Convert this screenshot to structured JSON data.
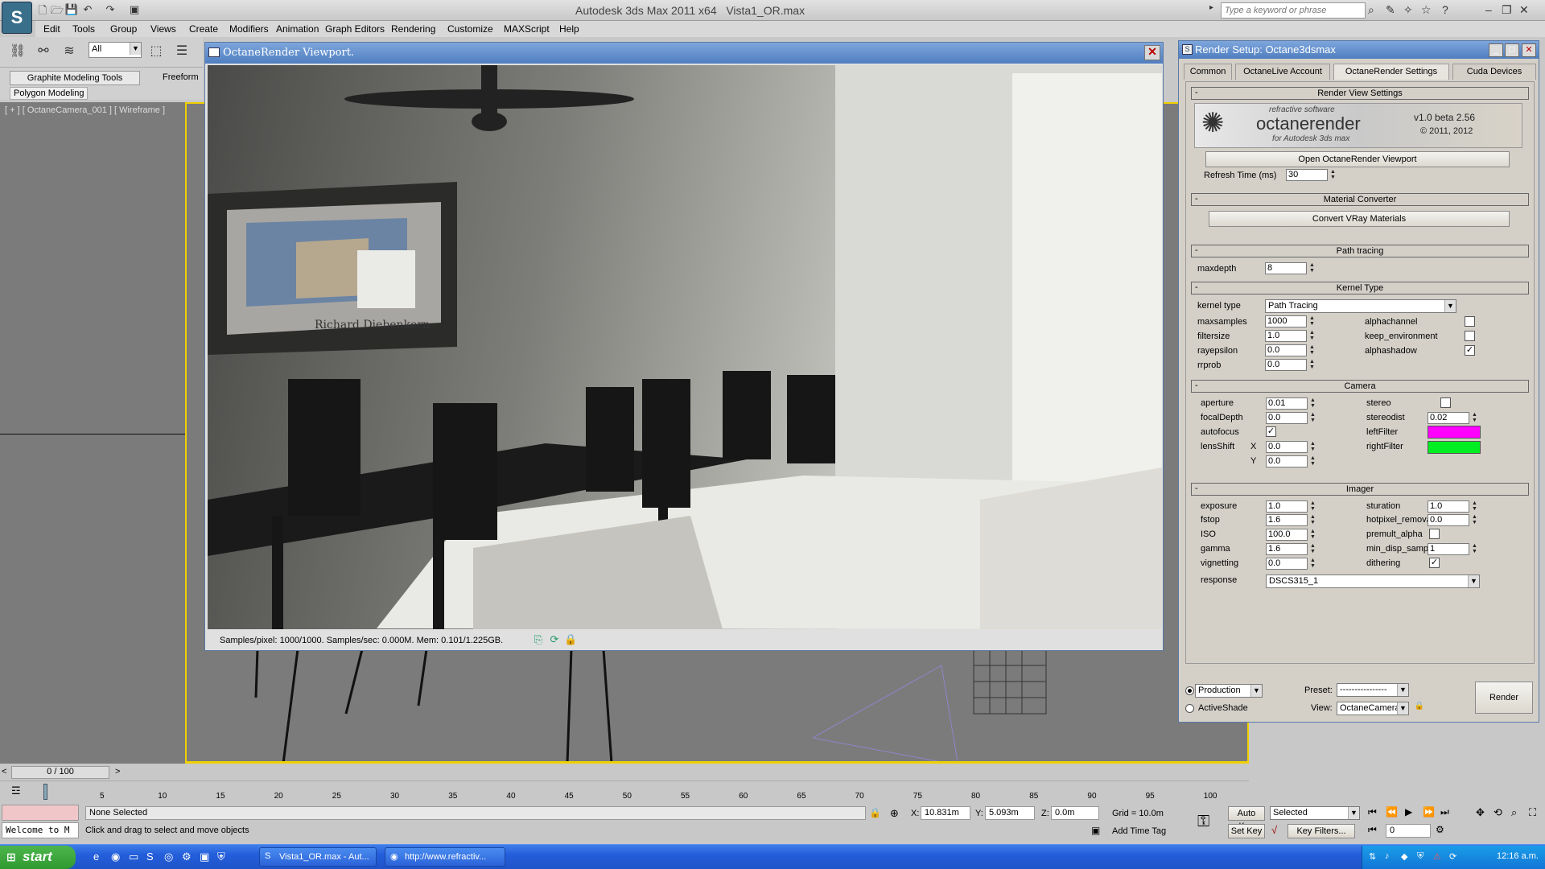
{
  "titlebar": {
    "app_title": "Autodesk 3ds Max  2011 x64",
    "file_name": "Vista1_OR.max",
    "search_placeholder": "Type a keyword or phrase",
    "logo": "3ds-max-logo"
  },
  "menu": [
    "Edit",
    "Tools",
    "Group",
    "Views",
    "Create",
    "Modifiers",
    "Animation",
    "Graph Editors",
    "Rendering",
    "Customize",
    "MAXScript",
    "Help"
  ],
  "toolbar": {
    "selection_filter": "All"
  },
  "ribbon": {
    "tab_graphite": "Graphite Modeling Tools",
    "tab_freeform": "Freeform",
    "sub_polygon": "Polygon Modeling"
  },
  "viewport": {
    "label": "[ + ] [ OctaneCamera_001 ] [ Wireframe ]"
  },
  "octane_viewport": {
    "title": "OctaneRender Viewport.",
    "status": "Samples/pixel: 1000/1000. Samples/sec: 0.000M. Mem: 0.101/1.225GB.",
    "close": "✕",
    "painting_text": "Richard Diebenkorn"
  },
  "render_setup": {
    "title": "Render Setup: Octane3dsmax",
    "tabs": [
      "Common",
      "OctaneLive Account",
      "OctaneRender Settings",
      "Cuda Devices"
    ],
    "render_view_settings": {
      "header": "Render View Settings",
      "banner_brand": "octanerender",
      "banner_sub": "for Autodesk 3ds max",
      "banner_company": "refractive software",
      "banner_version": "v1.0 beta 2.56",
      "banner_copy": "© 2011, 2012",
      "open_button": "Open OctaneRender Viewport",
      "refresh_label": "Refresh Time (ms)",
      "refresh_value": "30"
    },
    "material_converter": {
      "header": "Material Converter",
      "convert_button": "Convert VRay Materials"
    },
    "path_tracing": {
      "header": "Path tracing",
      "maxdepth_label": "maxdepth",
      "maxdepth_value": "8"
    },
    "kernel": {
      "header": "Kernel Type",
      "kernel_type_label": "kernel type",
      "kernel_type_value": "Path Tracing",
      "maxsamples_label": "maxsamples",
      "maxsamples_value": "1000",
      "filtersize_label": "filtersize",
      "filtersize_value": "1.0",
      "rayepsilon_label": "rayepsilon",
      "rayepsilon_value": "0.0",
      "rrprob_label": "rrprob",
      "rrprob_value": "0.0",
      "alphachannel_label": "alphachannel",
      "alphachannel": false,
      "keep_env_label": "keep_environment",
      "keep_env": false,
      "alphashadow_label": "alphashadow",
      "alphashadow": true
    },
    "camera": {
      "header": "Camera",
      "aperture_label": "aperture",
      "aperture_value": "0.01",
      "focal_label": "focalDepth",
      "focal_value": "0.0",
      "autofocus_label": "autofocus",
      "autofocus": true,
      "lensshift_label": "lensShift",
      "x_label": "X",
      "x_value": "0.0",
      "y_label": "Y",
      "y_value": "0.0",
      "stereo_label": "stereo",
      "stereo": false,
      "stereodist_label": "stereodist",
      "stereodist_value": "0.02",
      "leftfilter_label": "leftFilter",
      "leftfilter_color": "#ff00ff",
      "rightfilter_label": "rightFilter",
      "rightfilter_color": "#00ee22"
    },
    "imager": {
      "header": "Imager",
      "exposure_label": "exposure",
      "exposure_value": "1.0",
      "fstop_label": "fstop",
      "fstop_value": "1.6",
      "iso_label": "ISO",
      "iso_value": "100.0",
      "gamma_label": "gamma",
      "gamma_value": "1.6",
      "vignetting_label": "vignetting",
      "vignetting_value": "0.0",
      "response_label": "response",
      "response_value": "DSCS315_1",
      "saturation_label": "sturation",
      "saturation_value": "1.0",
      "hotpixel_label": "hotpixel_removal",
      "hotpixel_value": "0.0",
      "premult_label": "premult_alpha",
      "premult": false,
      "mindisp_label": "min_disp_samples",
      "mindisp_value": "1",
      "dithering_label": "dithering",
      "dithering": true
    },
    "footer": {
      "production_label": "Production",
      "production_dd": "Production",
      "activeshade_label": "ActiveShade",
      "preset_label": "Preset:",
      "preset_value": "----------------",
      "view_label": "View:",
      "view_value": "OctaneCamera_",
      "render_button": "Render"
    }
  },
  "timeline": {
    "frame_label": "0 / 100",
    "ticks": [
      "5",
      "10",
      "15",
      "20",
      "25",
      "30",
      "35",
      "40",
      "45",
      "50",
      "55",
      "60",
      "65",
      "70",
      "75",
      "80",
      "85",
      "90",
      "95",
      "100"
    ]
  },
  "status": {
    "welcome": "Welcome to M",
    "selection": "None Selected",
    "prompt": "Click and drag to select and move objects",
    "x_label": "X:",
    "x_value": "10.831m",
    "y_label": "Y:",
    "y_value": "5.093m",
    "z_label": "Z:",
    "z_value": "0.0m",
    "grid": "Grid = 10.0m",
    "add_time_tag": "Add Time Tag",
    "auto_key": "Auto Key",
    "set_key": "Set Key",
    "key_mode": "Selected",
    "key_filters": "Key Filters...",
    "frame_field": "0"
  },
  "taskbar": {
    "start": "start",
    "task1": "Vista1_OR.max - Aut...",
    "task2": "http://www.refractiv...",
    "clock": "12:16 a.m."
  }
}
